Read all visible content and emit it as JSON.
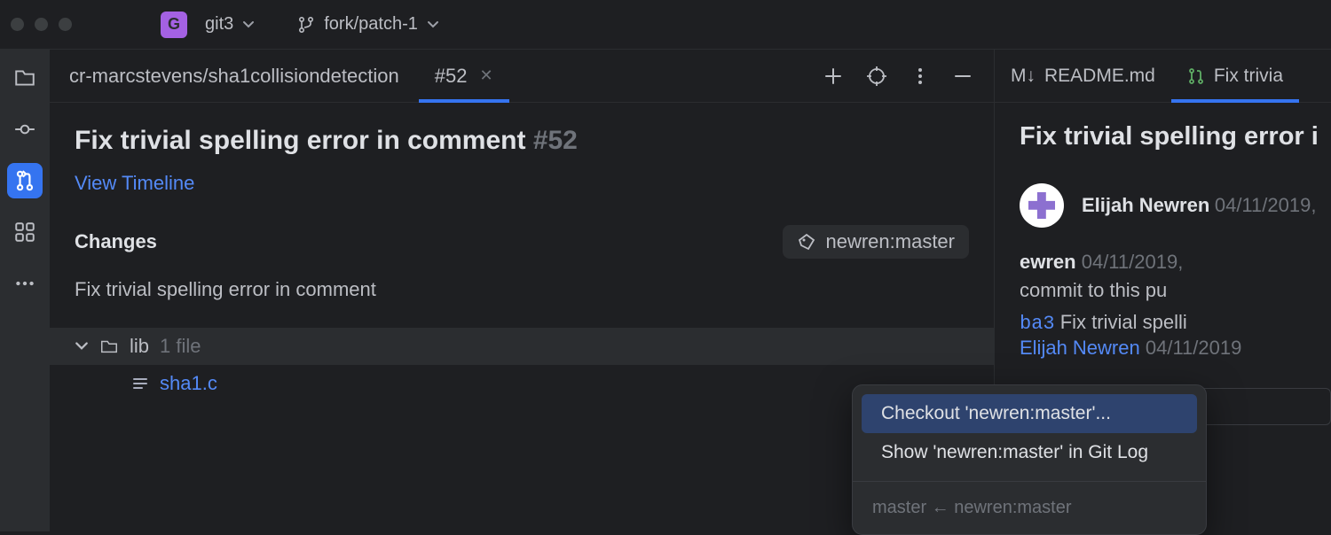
{
  "titlebar": {
    "project_badge": "G",
    "project_name": "git3",
    "branch_name": "fork/patch-1"
  },
  "tabs": {
    "breadcrumb": "cr-marcstevens/sha1collisiondetection",
    "active_tab": "#52"
  },
  "pr": {
    "title": "Fix trivial spelling error in comment",
    "number": "#52",
    "view_timeline": "View Timeline",
    "changes_label": "Changes",
    "branch_tag": "newren:master",
    "commit_message": "Fix trivial spelling error in comment",
    "folder": "lib",
    "folder_count": "1 file",
    "file": "sha1.c"
  },
  "menu": {
    "item1": "Checkout 'newren:master'...",
    "item2": "Show 'newren:master' in Git Log",
    "note": "master ← newren:master"
  },
  "right": {
    "tab_readme": "README.md",
    "tab_pr": "Fix trivia",
    "title": "Fix trivial spelling error i",
    "author_name": "Elijah Newren",
    "author_date": "04/11/2019,",
    "line2_name": "ewren",
    "line2_date": "04/11/2019,",
    "push_text": " commit to this pu",
    "commit_hash": "ba3",
    "commit_title": "Fix trivial spelli",
    "by_author": "Elijah Newren",
    "by_date": "04/11/2019"
  }
}
